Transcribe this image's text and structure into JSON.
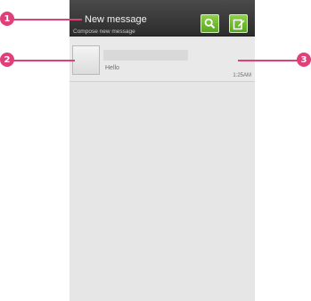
{
  "header": {
    "title": "New message",
    "subtitle": "Compose new message",
    "search_icon": "search-icon",
    "compose_icon": "compose-icon"
  },
  "threads": [
    {
      "name": "",
      "snippet": "Hello",
      "time": "1:25AM"
    }
  ],
  "callouts": [
    "1",
    "2",
    "3"
  ],
  "colors": {
    "callout": "#e0407a",
    "titlebar": "#3a3a3a",
    "list_bg": "#e6e6e6",
    "button_green": "#6ab82a"
  }
}
